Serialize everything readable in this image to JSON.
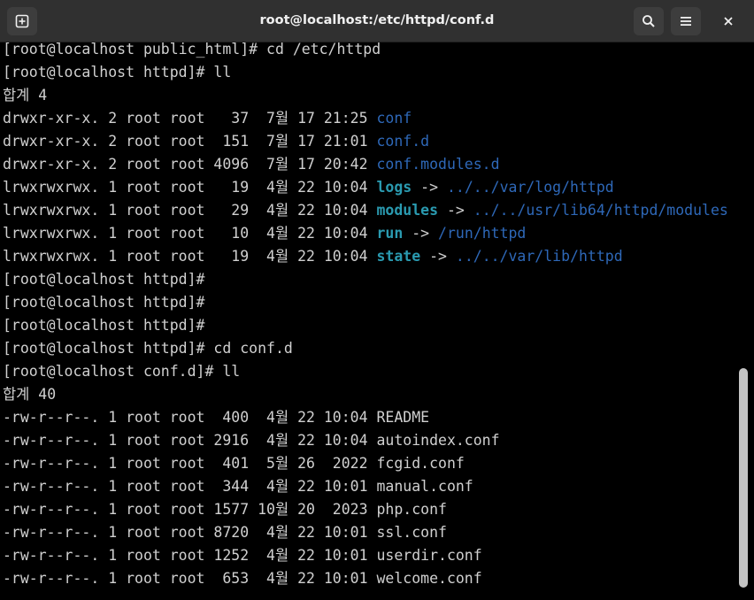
{
  "window": {
    "title": "root@localhost:/etc/httpd/conf.d",
    "icons": {
      "new_tab": "new-tab-icon",
      "search": "search-icon",
      "menu": "hamburger-menu-icon",
      "close": "close-icon"
    }
  },
  "terminal": {
    "lines": [
      {
        "segments": [
          {
            "text": "[root@localhost public_html]# cd /etc/httpd",
            "style": "plain"
          }
        ]
      },
      {
        "segments": [
          {
            "text": "[root@localhost httpd]# ll",
            "style": "plain"
          }
        ]
      },
      {
        "segments": [
          {
            "text": "합계 4",
            "style": "plain"
          }
        ]
      },
      {
        "segments": [
          {
            "text": "drwxr-xr-x. 2 root root   37  7월 17 21:25 ",
            "style": "plain"
          },
          {
            "text": "conf",
            "style": "dir"
          }
        ]
      },
      {
        "segments": [
          {
            "text": "drwxr-xr-x. 2 root root  151  7월 17 21:01 ",
            "style": "plain"
          },
          {
            "text": "conf.d",
            "style": "dir"
          }
        ]
      },
      {
        "segments": [
          {
            "text": "drwxr-xr-x. 2 root root 4096  7월 17 20:42 ",
            "style": "plain"
          },
          {
            "text": "conf.modules.d",
            "style": "dir"
          }
        ]
      },
      {
        "segments": [
          {
            "text": "lrwxrwxrwx. 1 root root   19  4월 22 10:04 ",
            "style": "plain"
          },
          {
            "text": "logs",
            "style": "link"
          },
          {
            "text": " -> ",
            "style": "plain"
          },
          {
            "text": "../../var/log/httpd",
            "style": "target"
          }
        ]
      },
      {
        "segments": [
          {
            "text": "lrwxrwxrwx. 1 root root   29  4월 22 10:04 ",
            "style": "plain"
          },
          {
            "text": "modules",
            "style": "link"
          },
          {
            "text": " -> ",
            "style": "plain"
          },
          {
            "text": "../../usr/lib64/httpd/modules",
            "style": "target"
          }
        ]
      },
      {
        "segments": [
          {
            "text": "lrwxrwxrwx. 1 root root   10  4월 22 10:04 ",
            "style": "plain"
          },
          {
            "text": "run",
            "style": "link"
          },
          {
            "text": " -> ",
            "style": "plain"
          },
          {
            "text": "/run/httpd",
            "style": "target"
          }
        ]
      },
      {
        "segments": [
          {
            "text": "lrwxrwxrwx. 1 root root   19  4월 22 10:04 ",
            "style": "plain"
          },
          {
            "text": "state",
            "style": "link"
          },
          {
            "text": " -> ",
            "style": "plain"
          },
          {
            "text": "../../var/lib/httpd",
            "style": "target"
          }
        ]
      },
      {
        "segments": [
          {
            "text": "[root@localhost httpd]#",
            "style": "plain"
          }
        ]
      },
      {
        "segments": [
          {
            "text": "[root@localhost httpd]#",
            "style": "plain"
          }
        ]
      },
      {
        "segments": [
          {
            "text": "[root@localhost httpd]#",
            "style": "plain"
          }
        ]
      },
      {
        "segments": [
          {
            "text": "[root@localhost httpd]# cd conf.d",
            "style": "plain"
          }
        ]
      },
      {
        "segments": [
          {
            "text": "[root@localhost conf.d]# ll",
            "style": "plain"
          }
        ]
      },
      {
        "segments": [
          {
            "text": "합계 40",
            "style": "plain"
          }
        ]
      },
      {
        "segments": [
          {
            "text": "-rw-r--r--. 1 root root  400  4월 22 10:04 README",
            "style": "plain"
          }
        ]
      },
      {
        "segments": [
          {
            "text": "-rw-r--r--. 1 root root 2916  4월 22 10:04 autoindex.conf",
            "style": "plain"
          }
        ]
      },
      {
        "segments": [
          {
            "text": "-rw-r--r--. 1 root root  401  5월 26  2022 fcgid.conf",
            "style": "plain"
          }
        ]
      },
      {
        "segments": [
          {
            "text": "-rw-r--r--. 1 root root  344  4월 22 10:01 manual.conf",
            "style": "plain"
          }
        ]
      },
      {
        "segments": [
          {
            "text": "-rw-r--r--. 1 root root 1577 10월 20  2023 php.conf",
            "style": "plain"
          }
        ]
      },
      {
        "segments": [
          {
            "text": "-rw-r--r--. 1 root root 8720  4월 22 10:01 ssl.conf",
            "style": "plain"
          }
        ]
      },
      {
        "segments": [
          {
            "text": "-rw-r--r--. 1 root root 1252  4월 22 10:01 userdir.conf",
            "style": "plain"
          }
        ]
      },
      {
        "segments": [
          {
            "text": "-rw-r--r--. 1 root root  653  4월 22 10:01 welcome.conf",
            "style": "plain"
          }
        ]
      }
    ]
  },
  "colors": {
    "background": "#000000",
    "text": "#d0d0d0",
    "directory": "#2e68b8",
    "symlink": "#2a9ab0",
    "titlebar": "#303030"
  }
}
